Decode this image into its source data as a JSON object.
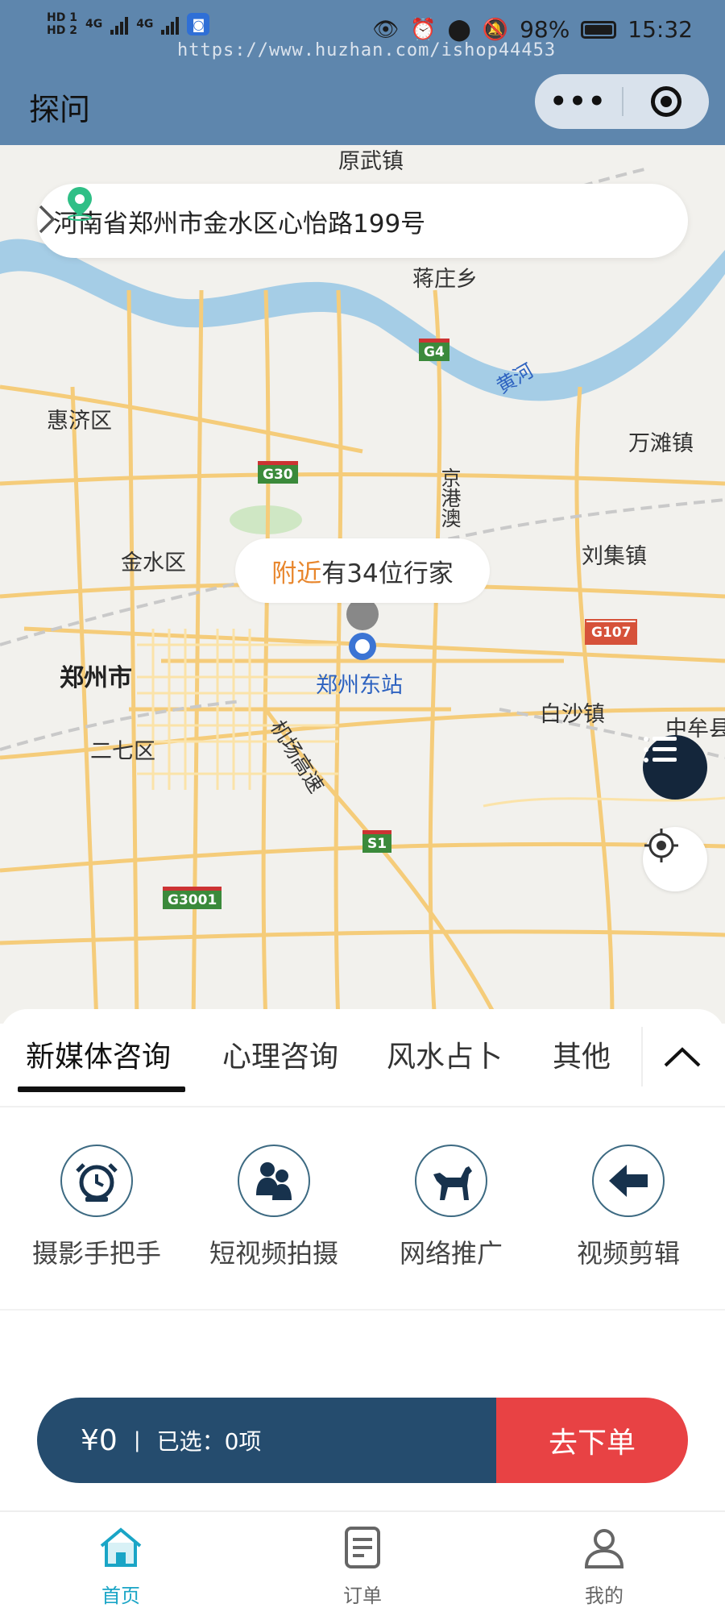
{
  "status_bar": {
    "hd1": "HD 1",
    "hd2": "HD 2",
    "net1": "4G",
    "net2": "4G",
    "battery": "98%",
    "time": "15:32",
    "watermark": "https://www.huzhan.com/ishop44453"
  },
  "header": {
    "title": "探问",
    "more_label": "•••"
  },
  "map": {
    "address": "河南省郑州市金水区心怡路199号",
    "nearby_prefix": "附近",
    "nearby_rest": "有34位行家",
    "places": {
      "yuanwu": "原武镇",
      "jiangzhuang": "蒋庄乡",
      "huangriver": "黄河",
      "huiji": "惠济区",
      "wantan": "万滩镇",
      "jingang": "京港澳",
      "jinshui": "金水区",
      "liuji": "刘集镇",
      "zhengzhou": "郑州市",
      "station": "郑州东站",
      "baisha": "白沙镇",
      "zhongmou": "中牟县",
      "erqi": "二七区",
      "airport": "机场高速"
    },
    "highways": {
      "g4": "G4",
      "g30": "G30",
      "g107": "G107",
      "s1": "S1",
      "g3001": "G3001"
    }
  },
  "tabs": [
    "新媒体咨询",
    "心理咨询",
    "风水占卜",
    "其他"
  ],
  "services": [
    {
      "label": "摄影手把手",
      "icon": "alarm-clock-icon"
    },
    {
      "label": "短视频拍摄",
      "icon": "people-icon"
    },
    {
      "label": "网络推广",
      "icon": "dog-icon"
    },
    {
      "label": "视频剪辑",
      "icon": "arrow-left-icon"
    }
  ],
  "order": {
    "price": "¥0",
    "divider": "|",
    "selected": "已选：0项",
    "submit": "去下单"
  },
  "tabbar": [
    {
      "label": "首页"
    },
    {
      "label": "订单"
    },
    {
      "label": "我的"
    }
  ],
  "colors": {
    "header_bg": "#5e86ad",
    "accent_orange": "#e8862c",
    "order_bar": "#254c6e",
    "order_button": "#e84244",
    "tab_active": "#1aa5c6"
  }
}
